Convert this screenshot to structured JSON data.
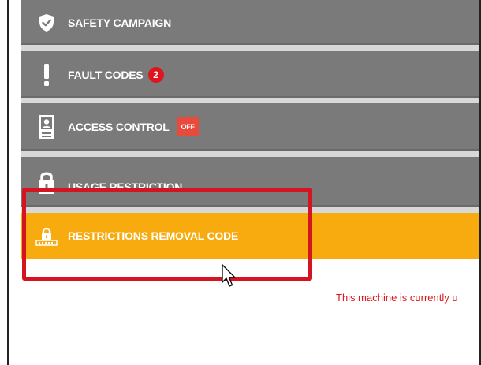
{
  "menu": {
    "safety_campaign": "SAFETY CAMPAIGN",
    "fault_codes": "FAULT CODES",
    "fault_count": "2",
    "access_control": "ACCESS CONTROL",
    "access_status": "OFF",
    "usage_restriction": "USAGE RESTRICTION",
    "restrictions_removal_code": "RESTRICTIONS REMOVAL CODE"
  },
  "content": {
    "notice": "This machine is currently u"
  },
  "colors": {
    "row_gray": "#7a7a7a",
    "active_orange": "#f7ab0f",
    "alert_red": "#e0141c",
    "highlight_red": "#d41420"
  },
  "icons": [
    "shield-check-icon",
    "exclamation-icon",
    "badge-id-icon",
    "lock-icon",
    "lock-keypad-icon",
    "cursor-icon"
  ]
}
